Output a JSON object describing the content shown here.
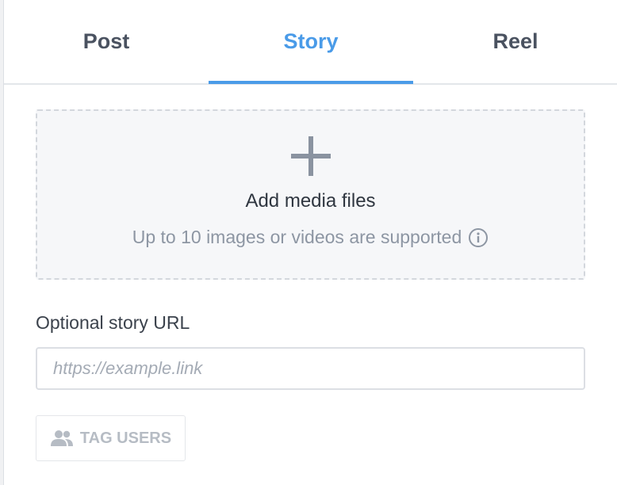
{
  "tabs": [
    {
      "label": "Post",
      "active": false
    },
    {
      "label": "Story",
      "active": true
    },
    {
      "label": "Reel",
      "active": false
    }
  ],
  "dropzone": {
    "icon": "plus-icon",
    "title": "Add media files",
    "subtitle": "Up to 10 images or videos are supported",
    "info_icon": "info-icon"
  },
  "url_field": {
    "label": "Optional story URL",
    "value": "",
    "placeholder": "https://example.link"
  },
  "tag_users": {
    "label": "TAG USERS",
    "icon": "users-icon"
  },
  "colors": {
    "accent": "#4a9be8",
    "text": "#4a5260",
    "muted": "#8d96a3",
    "disabled": "#b6bcc4"
  }
}
